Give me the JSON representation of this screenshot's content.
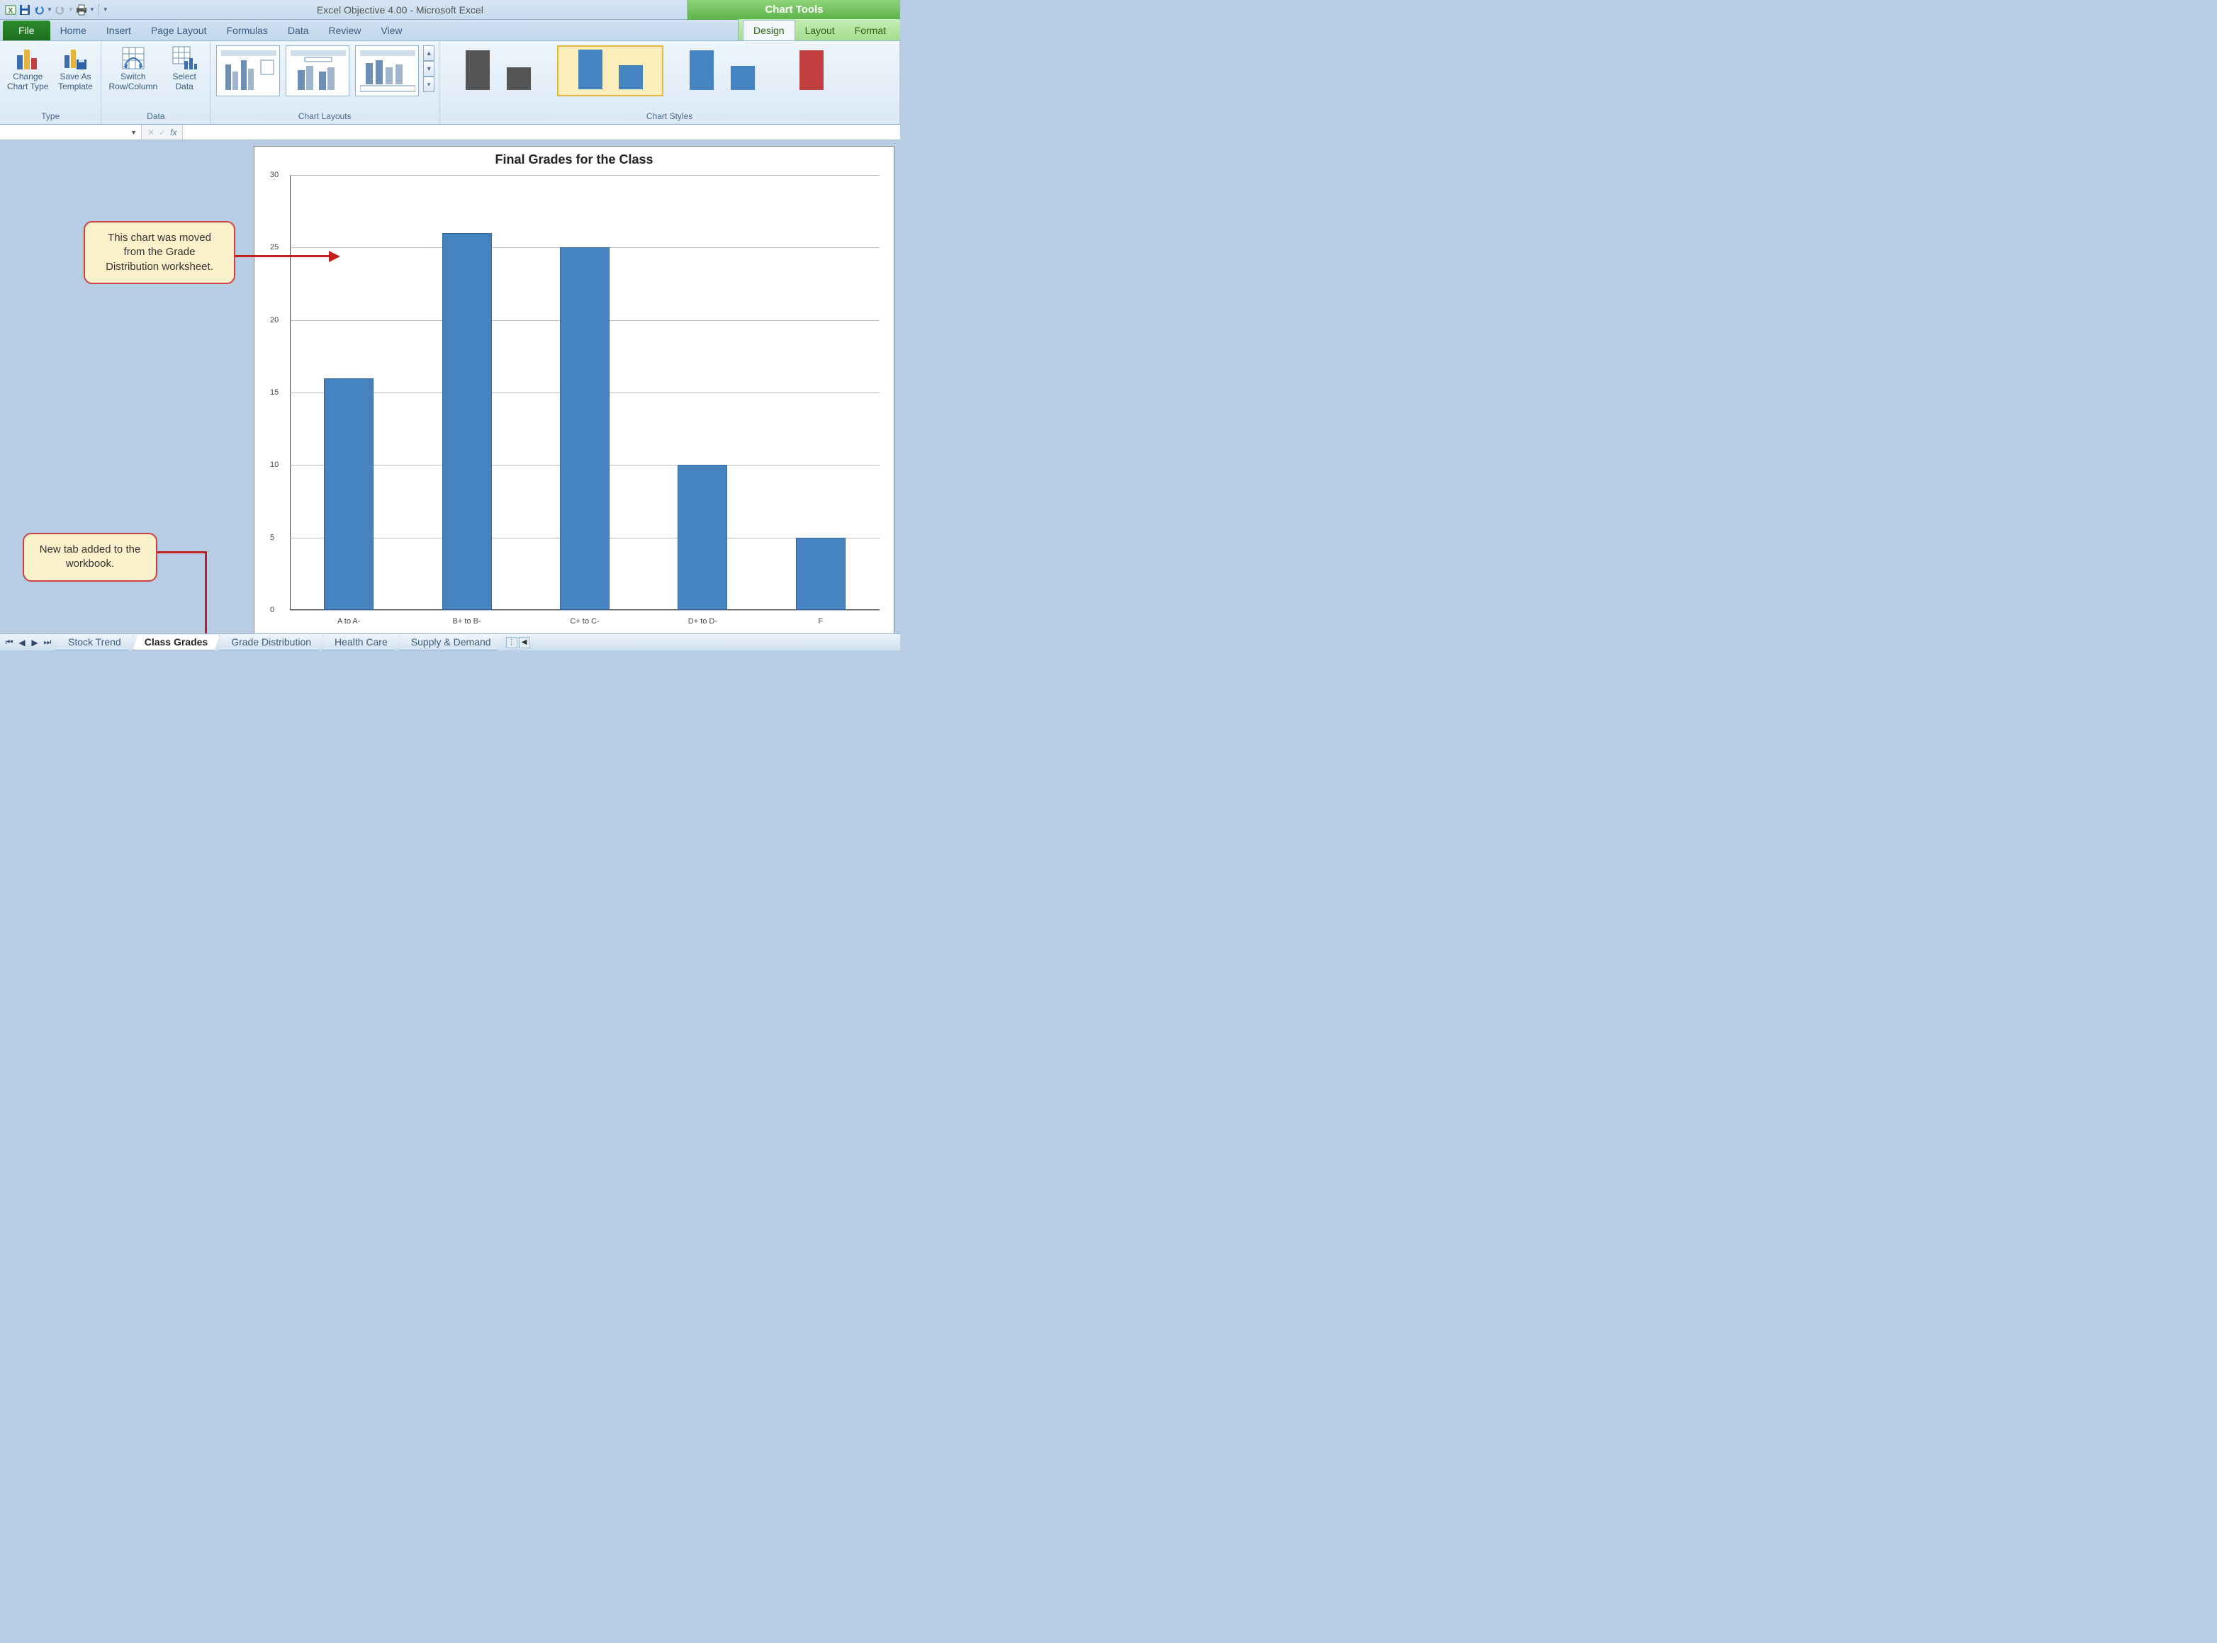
{
  "app_title": "Excel Objective 4.00 - Microsoft Excel",
  "context_title": "Chart Tools",
  "tabs": {
    "file": "File",
    "home": "Home",
    "insert": "Insert",
    "page_layout": "Page Layout",
    "formulas": "Formulas",
    "data": "Data",
    "review": "Review",
    "view": "View",
    "design": "Design",
    "layout": "Layout",
    "format": "Format"
  },
  "ribbon": {
    "type_group": "Type",
    "change_chart_type": "Change\nChart Type",
    "save_as_template": "Save As\nTemplate",
    "data_group": "Data",
    "switch_row_col": "Switch\nRow/Column",
    "select_data": "Select\nData",
    "chart_layouts": "Chart Layouts",
    "chart_styles": "Chart Styles"
  },
  "formula_bar": {
    "fx": "fx"
  },
  "chart_data": {
    "type": "bar",
    "title": "Final Grades for the Class",
    "categories": [
      "A to A-",
      "B+ to B-",
      "C+ to C-",
      "D+ to D-",
      "F"
    ],
    "values": [
      16,
      26,
      25,
      10,
      5
    ],
    "ylim": [
      0,
      30
    ],
    "yticks": [
      0,
      5,
      10,
      15,
      20,
      25,
      30
    ],
    "xlabel": "",
    "ylabel": ""
  },
  "callouts": {
    "moved": "This chart was moved from the Grade Distribution worksheet.",
    "newtab": "New tab added to the workbook."
  },
  "sheets": [
    "Stock Trend",
    "Class Grades",
    "Grade Distribution",
    "Health Care",
    "Supply & Demand"
  ],
  "active_sheet_index": 1
}
